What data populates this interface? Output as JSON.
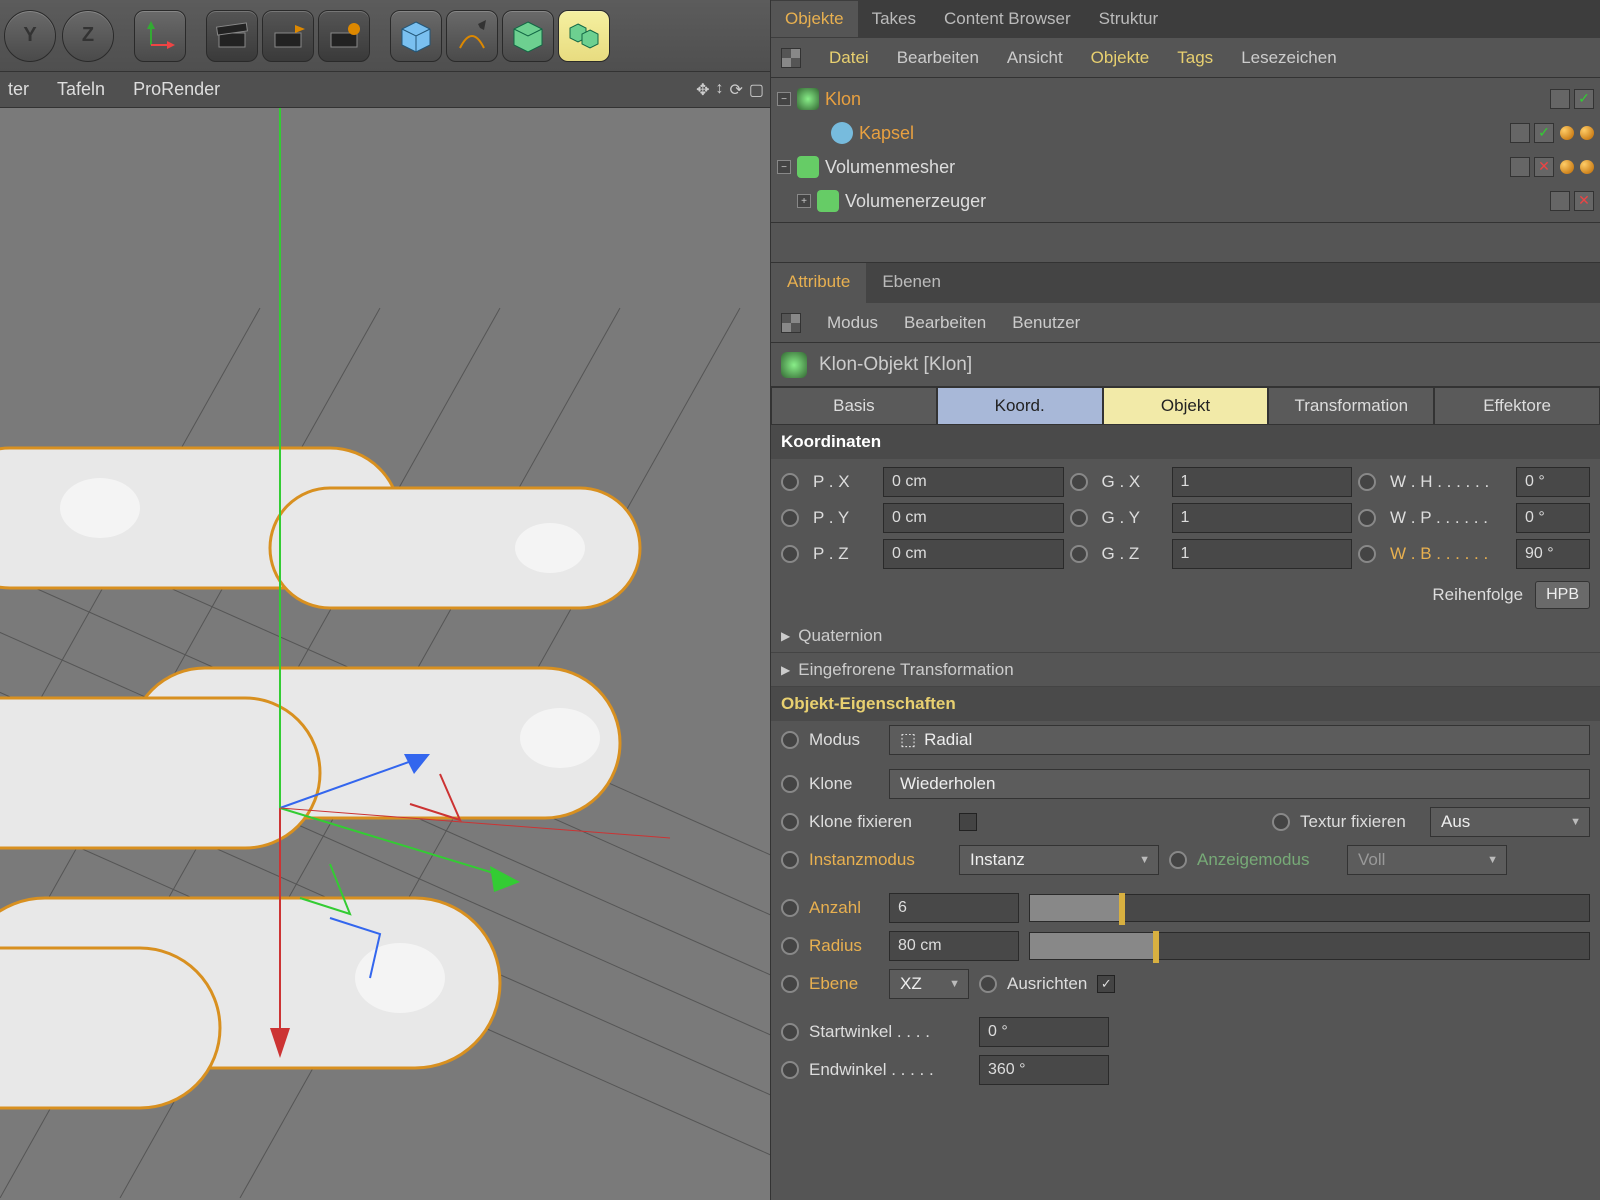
{
  "toolbar": {
    "axis_y": "Y",
    "axis_z": "Z"
  },
  "viewport_menu": {
    "item1": "ter",
    "item2": "Tafeln",
    "item3": "ProRender"
  },
  "top_tabs": {
    "objekte": "Objekte",
    "takes": "Takes",
    "content": "Content Browser",
    "struktur": "Struktur"
  },
  "om_menu": {
    "datei": "Datei",
    "bearbeiten": "Bearbeiten",
    "ansicht": "Ansicht",
    "objekte": "Objekte",
    "tags": "Tags",
    "lesezeichen": "Lesezeichen"
  },
  "tree": {
    "klon": "Klon",
    "kapsel": "Kapsel",
    "volmesher": "Volumenmesher",
    "volerz": "Volumenerzeuger"
  },
  "attr_tabs": {
    "attribute": "Attribute",
    "ebenen": "Ebenen"
  },
  "attr_menu": {
    "modus": "Modus",
    "bearbeiten": "Bearbeiten",
    "benutzer": "Benutzer"
  },
  "obj_title": "Klon-Objekt [Klon]",
  "subtabs": {
    "basis": "Basis",
    "koord": "Koord.",
    "objekt": "Objekt",
    "transformation": "Transformation",
    "effektoren": "Effektore"
  },
  "sections": {
    "koordinaten": "Koordinaten",
    "quaternion": "Quaternion",
    "eingefroren": "Eingefrorene Transformation",
    "objeig": "Objekt-Eigenschaften"
  },
  "coords": {
    "px_l": "P . X",
    "px": "0 cm",
    "gx_l": "G . X",
    "gx": "1",
    "wh_l": "W . H . . . . . .",
    "wh": "0 °",
    "py_l": "P . Y",
    "py": "0 cm",
    "gy_l": "G . Y",
    "gy": "1",
    "wp_l": "W . P . . . . . .",
    "wp": "0 °",
    "pz_l": "P . Z",
    "pz": "0 cm",
    "gz_l": "G . Z",
    "gz": "1",
    "wb_l": "W . B . . . . . .",
    "wb": "90 °",
    "order_l": "Reihenfolge",
    "order": "HPB"
  },
  "props": {
    "modus_l": "Modus",
    "modus": "Radial",
    "klone_l": "Klone",
    "klone": "Wiederholen",
    "klonefix_l": "Klone fixieren",
    "texturfix_l": "Textur fixieren",
    "texturfix": "Aus",
    "instanz_l": "Instanzmodus",
    "instanz": "Instanz",
    "anzeige_l": "Anzeigemodus",
    "anzeige": "Voll",
    "anzahl_l": "Anzahl",
    "anzahl": "6",
    "radius_l": "Radius",
    "radius": "80 cm",
    "ebene_l": "Ebene",
    "ebene": "XZ",
    "ausrichten_l": "Ausrichten",
    "start_l": "Startwinkel . . . .",
    "start": "0 °",
    "end_l": "Endwinkel . . . . .",
    "end": "360 °"
  }
}
